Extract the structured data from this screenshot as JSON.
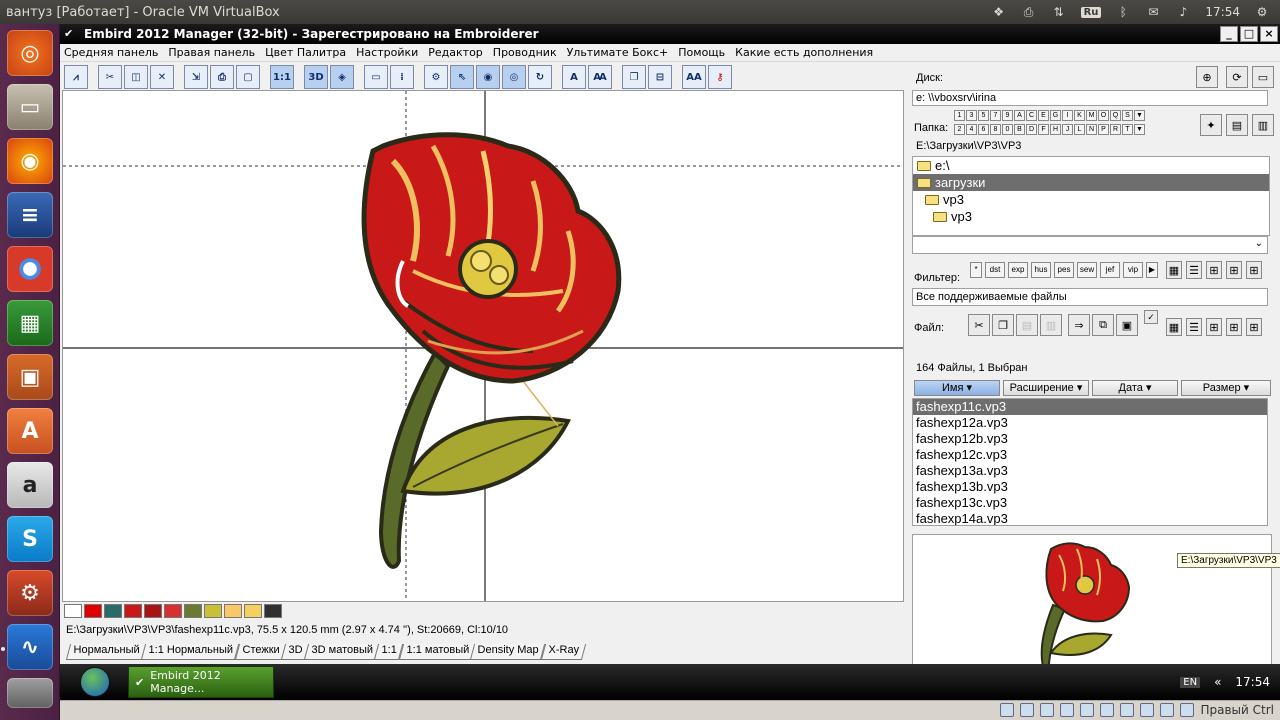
{
  "os_bar": {
    "title": "вантуз [Работает] - Oracle VM VirtualBox",
    "kbd_layout": "Ru",
    "time": "17:54"
  },
  "window": {
    "title": "Embird 2012 Manager (32-bit) - Зарегестрировано на Embroiderer",
    "menu": [
      "Средняя панель",
      "Правая панель",
      "Цвет Палитра",
      "Настройки",
      "Редактор",
      "Проводник",
      "Ультимате Бокс+",
      "Помощь",
      "Какие есть дополнения"
    ]
  },
  "toolbar": {
    "one_to_one": "1:1",
    "three_d": "3D",
    "font_a": "A",
    "font_aa": "AA"
  },
  "palette": {
    "colors": [
      "#ffffff",
      "#e00000",
      "#2a6a6a",
      "#c81818",
      "#a81414",
      "#d83030",
      "#6a7a30",
      "#c8c038",
      "#f8c868",
      "#f4d060",
      "#303030"
    ]
  },
  "status_line": "E:\\Загрузки\\VP3\\VP3\\fashexp11c.vp3, 75.5 x 120.5 mm (2.97 x 4.74 ''), St:20669, Cl:10/10",
  "view_tabs": [
    "Нормальный",
    "1:1 Нормальный",
    "Стежки",
    "3D",
    "3D матовый",
    "1:1",
    "1:1 матовый",
    "Density Map",
    "X-Ray"
  ],
  "right_panel": {
    "disk_label": "Диск:",
    "disk_value": "e: \\\\vboxsrv\\irina",
    "folder_label": "Папка:",
    "letters_row1": [
      "1",
      "3",
      "5",
      "7",
      "9",
      "A",
      "C",
      "E",
      "G",
      "I",
      "K",
      "M",
      "O",
      "Q",
      "S"
    ],
    "letters_row2": [
      "2",
      "4",
      "6",
      "8",
      "0",
      "B",
      "D",
      "F",
      "H",
      "J",
      "L",
      "N",
      "P",
      "R",
      "T"
    ],
    "path": "E:\\Загрузки\\VP3\\VP3",
    "tree": [
      {
        "label": "e:\\",
        "indent": 0,
        "selected": false
      },
      {
        "label": "загрузки",
        "indent": 0,
        "selected": true
      },
      {
        "label": "vp3",
        "indent": 1,
        "selected": false
      },
      {
        "label": "vp3",
        "indent": 2,
        "selected": false
      }
    ],
    "filter_label": "Фильтер:",
    "filter_buttons": [
      "*",
      "dst",
      "exp",
      "hus",
      "pes",
      "sew",
      "jef",
      "vip"
    ],
    "filter_value": "Все поддерживаемые файлы",
    "file_label": "Файл:",
    "file_count": "164 Файлы, 1 Выбран",
    "columns": [
      "Имя",
      "Расширение",
      "Дата",
      "Размер"
    ],
    "files": [
      "fashexp11c.vp3",
      "fashexp12a.vp3",
      "fashexp12b.vp3",
      "fashexp12c.vp3",
      "fashexp13a.vp3",
      "fashexp13b.vp3",
      "fashexp13c.vp3",
      "fashexp14a.vp3"
    ],
    "selected_file": 0,
    "tooltip": "E:\\Загрузки\\VP3\\VP3"
  },
  "taskbar": {
    "task_label": "Embird 2012 Manage...",
    "lang": "EN",
    "time": "17:54"
  },
  "vbox_status": {
    "host_key": "Правый Ctrl"
  }
}
